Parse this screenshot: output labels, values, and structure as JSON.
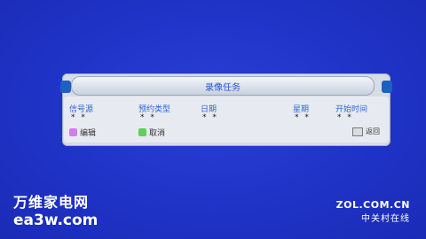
{
  "dialog": {
    "title": "录像任务",
    "columns": [
      "信号源",
      "预约类型",
      "日期",
      "星期",
      "开始时间"
    ],
    "values": [
      "* *",
      "* *",
      "* *",
      "* *",
      "* *"
    ]
  },
  "actions": {
    "edit_label": "编辑",
    "cancel_label": "取消",
    "back_label": "返回",
    "edit_color": "#d07ee8",
    "cancel_color": "#5fcf5f"
  },
  "watermarks": {
    "left_cn": "万维家电网",
    "left_en": "ea3w.com",
    "right_top": "ZOL.COM.CN",
    "right_bottom": "中关村在线"
  }
}
